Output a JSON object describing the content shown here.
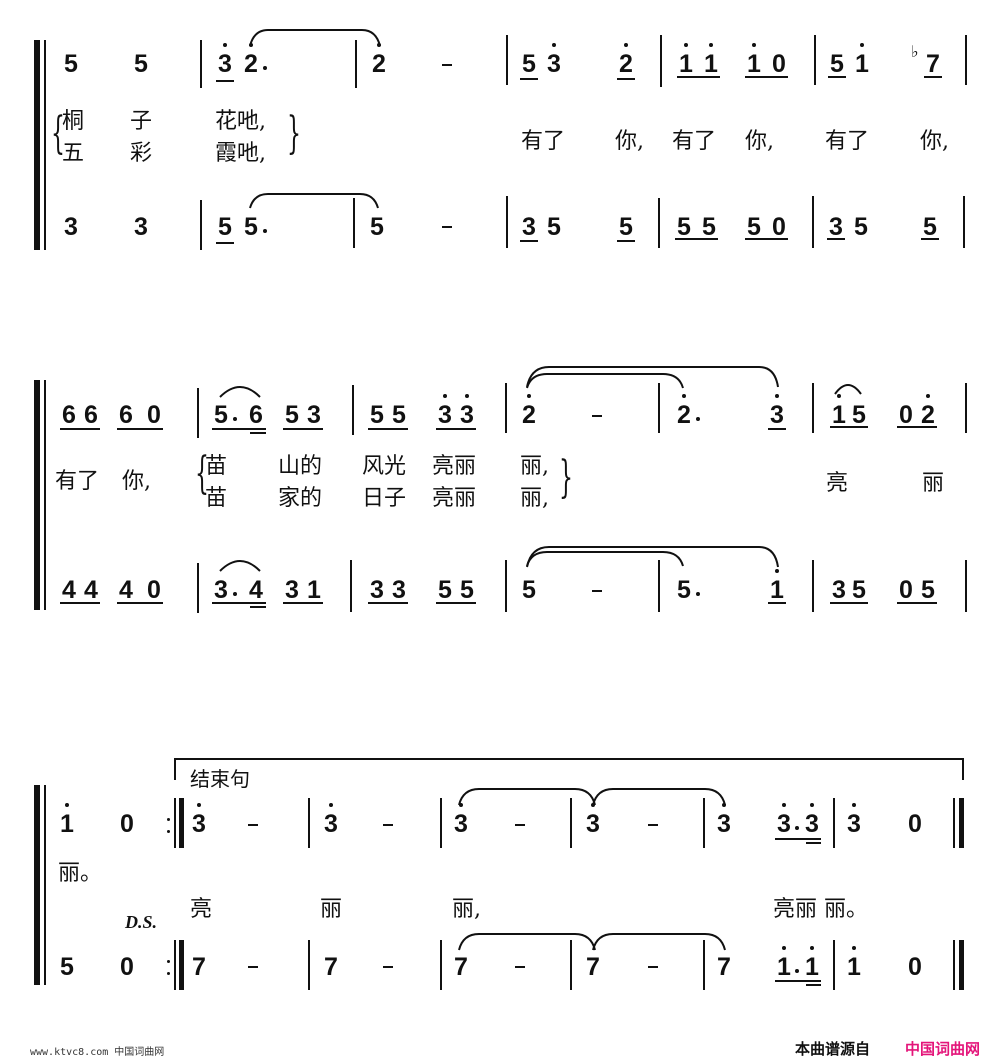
{
  "score": {
    "systems": [
      {
        "top_part": [
          [
            "5",
            "5"
          ],
          [
            "3̇(underline)",
            "2̇."
          ],
          [
            "2̇",
            "-"
          ],
          [
            "5 3̇ (underlined)",
            "2̇ (underlined)"
          ],
          [
            "i̇ i̇ (underlined)",
            "i̇ 0 (underlined)"
          ],
          [
            "5 i̇ (underlined)",
            "♭7 (underlined)"
          ]
        ],
        "lyrics_line1": [
          "桐",
          "子",
          "花吔,"
        ],
        "lyrics_line2": [
          "五",
          "彩",
          "霞吔,"
        ],
        "lyrics_shared": [
          "有了",
          "你,",
          "有了",
          "你,",
          "有了",
          "你,"
        ],
        "bottom_part": [
          [
            "3",
            "3"
          ],
          [
            "5 (underlined)",
            "5."
          ],
          [
            "5",
            "-"
          ],
          [
            "3 5 (underlined)",
            "5 (underlined)"
          ],
          [
            "5 5 (underlined)",
            "5 0 (underlined)"
          ],
          [
            "3 5 (underlined)",
            "5 (underlined)"
          ]
        ]
      },
      {
        "top_part": [
          [
            "6 6 (underlined)",
            "6 0 (underlined)"
          ],
          [
            "5. 6 (underlined)",
            "5 3 (underlined)"
          ],
          [
            "5 5 (underlined)",
            "3̇ 3̇ (underlined)"
          ],
          [
            "2̇",
            "-"
          ],
          [
            "2̇.",
            "3̇ (underlined)"
          ],
          [
            "i̇ 5 (underlined)",
            "0 2̇ (underlined)"
          ]
        ],
        "lyrics_pre": [
          "有了",
          "你,"
        ],
        "lyrics_line1": [
          "苗",
          "山的",
          "风光",
          "亮丽",
          "丽,"
        ],
        "lyrics_line2": [
          "苗",
          "家的",
          "日子",
          "亮丽",
          "丽,"
        ],
        "lyrics_post": [
          "亮",
          "丽"
        ],
        "bottom_part": [
          [
            "4 4 (underlined)",
            "4 0 (underlined)"
          ],
          [
            "3. 4 (underlined)",
            "3 1 (underlined)"
          ],
          [
            "3 3 (underlined)",
            "5 5 (underlined)"
          ],
          [
            "5",
            "-"
          ],
          [
            "5.",
            "i̇ (underlined)"
          ],
          [
            "3 5 (underlined)",
            "0 5 (underlined)"
          ]
        ]
      },
      {
        "section_label": "结束句",
        "ds_label": "D.S.",
        "top_part": [
          [
            "i̇",
            "0"
          ],
          [
            "3̇",
            "-"
          ],
          [
            "3̇",
            "-"
          ],
          [
            "3̇",
            "-"
          ],
          [
            "3̇",
            "-"
          ],
          [
            "3̇",
            "3̇.3̇ (underlined)"
          ],
          [
            "3̇",
            "0"
          ]
        ],
        "lyrics_end_repeat": "丽。",
        "lyrics": [
          "亮",
          "丽",
          "丽,",
          "亮丽 丽。"
        ],
        "bottom_part": [
          [
            "5",
            "0"
          ],
          [
            "7",
            "-"
          ],
          [
            "7",
            "-"
          ],
          [
            "7",
            "-"
          ],
          [
            "7",
            "-"
          ],
          [
            "7",
            "i̇.i̇ (underlined)"
          ],
          [
            "i̇",
            "0"
          ]
        ]
      }
    ]
  },
  "text": {
    "s1": {
      "top": [
        "5",
        "5",
        "3",
        "2",
        "2",
        "5",
        "3",
        "2",
        "1",
        "1",
        "1",
        "0",
        "5",
        "1",
        "7"
      ],
      "bot": [
        "3",
        "3",
        "5",
        "5",
        "5",
        "3",
        "5",
        "5",
        "5",
        "5",
        "5",
        "0",
        "3",
        "5",
        "5"
      ],
      "ly1": [
        "桐",
        "子",
        "花吔,"
      ],
      "ly2": [
        "五",
        "彩",
        "霞吔,"
      ],
      "shared": [
        "有了",
        "你,",
        "有了",
        "你,",
        "有了",
        "你,"
      ]
    },
    "s2": {
      "top": [
        "6",
        "6",
        "6",
        "0",
        "5",
        "6",
        "5",
        "3",
        "5",
        "5",
        "3",
        "3",
        "2",
        "2",
        "3",
        "1",
        "5",
        "0",
        "2"
      ],
      "bot": [
        "4",
        "4",
        "4",
        "0",
        "3",
        "4",
        "3",
        "1",
        "3",
        "3",
        "5",
        "5",
        "5",
        "5",
        "1",
        "3",
        "5",
        "0",
        "5"
      ],
      "pre": [
        "有了",
        "你,"
      ],
      "ly1": [
        "苗",
        "山的",
        "风光",
        "亮丽",
        "丽,"
      ],
      "ly2": [
        "苗",
        "家的",
        "日子",
        "亮丽",
        "丽,"
      ],
      "post": [
        "亮",
        "丽"
      ]
    },
    "s3": {
      "top": [
        "1",
        "0",
        "3",
        "3",
        "3",
        "3",
        "3",
        "3",
        "3",
        "3",
        "0"
      ],
      "bot": [
        "5",
        "0",
        "7",
        "7",
        "7",
        "7",
        "7",
        "1",
        "1",
        "1",
        "0"
      ],
      "end_repeat": "丽。",
      "ly": [
        "亮",
        "丽",
        "丽,",
        "亮丽 丽。"
      ],
      "section": "结束句",
      "ds": "D.S."
    },
    "dash": "–",
    "flat": "♭"
  },
  "footer": {
    "left": "www.ktvc8.com 中国词曲网",
    "right_prefix": "本曲谱源自",
    "right_brand": "中国词曲网",
    "brand_color": "#e4157a"
  }
}
